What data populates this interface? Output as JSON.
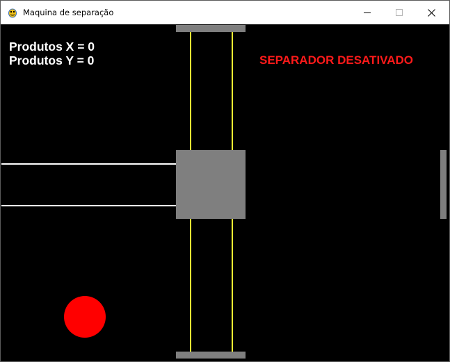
{
  "window": {
    "title": "Maquina de separação",
    "icon": "pygame-snake-icon",
    "controls": [
      "minimize-icon",
      "maximize-icon",
      "close-icon"
    ]
  },
  "hud": {
    "produtos_x": "Produtos X = 0",
    "produtos_y": "Produtos Y = 0"
  },
  "status": {
    "text": "SEPARADOR DESATIVADO",
    "color": "#ff1a1a"
  },
  "colors": {
    "background": "#000000",
    "block": "#7f7f7f",
    "rail": "#ffff33",
    "conveyor": "#ffffff",
    "product": "#ff0000"
  }
}
